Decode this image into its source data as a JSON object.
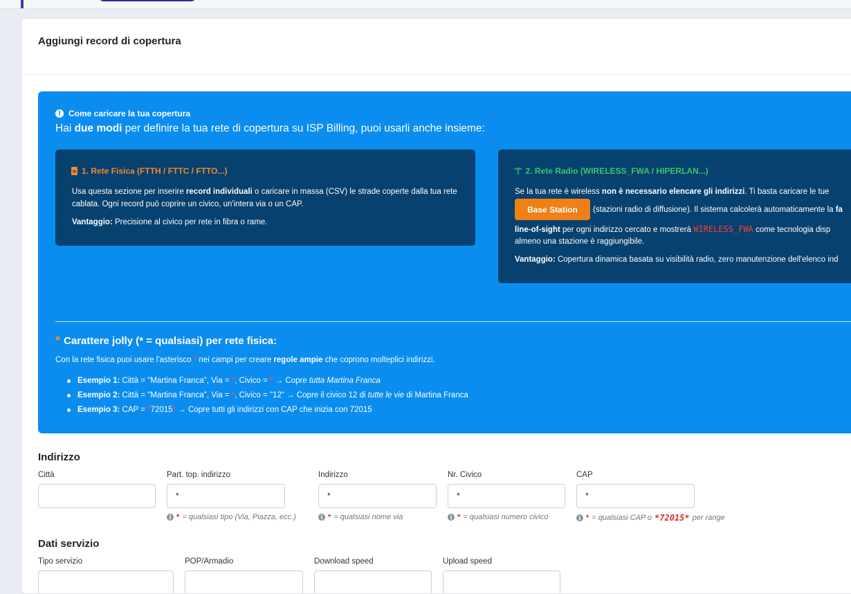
{
  "card": {
    "title": "Aggiungi record di copertura"
  },
  "info": {
    "heading": "Come caricare la tua copertura",
    "lead_pre": "Hai ",
    "lead_bold": "due modi",
    "lead_post": " per definire la tua rete di copertura su ISP Billing, puoi usarli anche insieme:",
    "physical": {
      "title": "1. Rete Fisica (FTTH / FTTC / FTTO...)",
      "p1_pre": "Usa questa sezione per inserire ",
      "p1_bold": "record individuali",
      "p1_post": " o caricare in massa (CSV) le strade coperte dalla tua rete cablata. Ogni record può coprire un civico, un'intera via o un CAP.",
      "adv_label": "Vantaggio:",
      "adv_text": " Precisione al civico per rete in fibra o rame."
    },
    "radio": {
      "title": "2. Rete Radio (WIRELESS_FWA / HIPERLAN...)",
      "p1_pre": "Se la tua rete è wireless ",
      "p1_bold": "non è necessario elencare gli indirizzi",
      "p1_post": ". Ti basta caricare le tue",
      "button": "Base Station",
      "p2_pre": "(stazioni radio di diffusione). Il sistema calcolerà automaticamente la ",
      "p2_bold": "fa",
      "p3_bold": "line-of-sight",
      "p3_mid": " per ogni indirizzo cercato e mostrerà ",
      "p3_code": "WIRELESS_FWA",
      "p3_post": " come tecnologia disp",
      "p4": "almeno una stazione è raggiungibile.",
      "adv_label": "Vantaggio:",
      "adv_text": " Copertura dinamica basata su visibilità radio, zero manutenzione dell'elenco ind"
    },
    "jolly": {
      "star": "*",
      "title": "Carattere jolly (* = qualsiasi) per rete fisica:",
      "text_pre": "Con la rete fisica puoi usare l'asterisco ",
      "text_star": "*",
      "text_mid": " nei campi per creare ",
      "text_bold": "regole ampie",
      "text_post": " che coprono molteplici indirizzi.",
      "examples": [
        {
          "label": "Esempio 1:",
          "a": " Città = \"Martina Franca\", Via = ",
          "s1": "*",
          "b": ", Civico = ",
          "s2": "*",
          "c": " → Copre ",
          "em": "tutta Martina Franca",
          "d": ""
        },
        {
          "label": "Esempio 2:",
          "a": " Città = \"Martina Franca\", Via = ",
          "s1": "*",
          "b": ", Civico = \"12\" → Copre il civico 12 di ",
          "em": "tutte le vie",
          "d": " di Martina Franca"
        },
        {
          "label": "Esempio 3:",
          "a": " CAP = ",
          "s1": "*",
          "b": "72015",
          "s2": "*",
          "c": " → Copre tutti gli indirizzi con CAP che inizia con 72015"
        }
      ]
    }
  },
  "address": {
    "title": "Indirizzo",
    "fields": [
      {
        "label": "Città",
        "value": ""
      },
      {
        "label": "Part. top. indirizzo",
        "value": "*",
        "hint_star": "*",
        "hint": " = qualsiasi tipo (Via, Piazza, ecc.)"
      },
      {
        "label": "Indirizzo",
        "value": "*",
        "hint_star": "*",
        "hint": " = qualsiasi nome via"
      },
      {
        "label": "Nr. Civico",
        "value": "*",
        "hint_star": "*",
        "hint": " = qualsiasi numero civico"
      },
      {
        "label": "CAP",
        "value": "*",
        "hint_star": "*",
        "hint": " = qualsiasi CAP o ",
        "hint_code": "*72015*",
        "hint_post": " per range"
      }
    ]
  },
  "service": {
    "title": "Dati servizio",
    "fields": [
      {
        "label": "Tipo servizio"
      },
      {
        "label": "POP/Armadio"
      },
      {
        "label": "Download speed"
      },
      {
        "label": "Upload speed"
      }
    ]
  }
}
